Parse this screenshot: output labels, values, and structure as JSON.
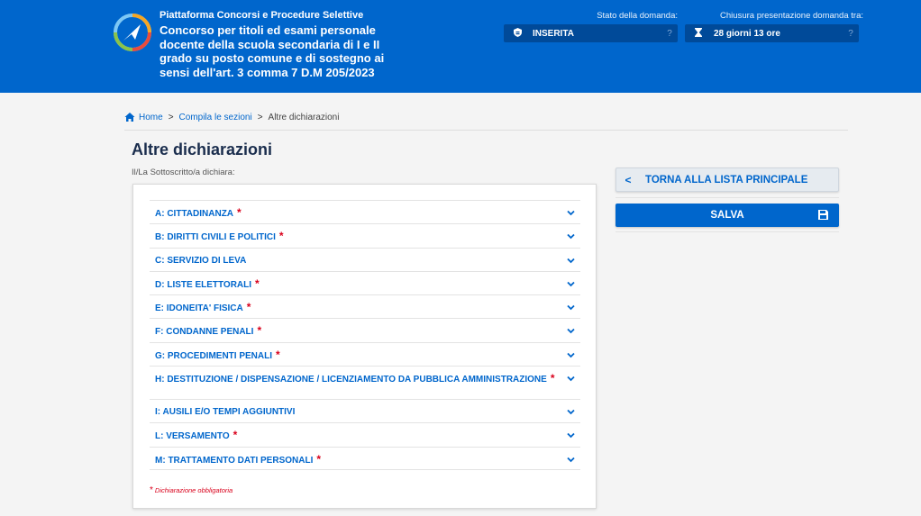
{
  "header": {
    "platform": "Piattaforma Concorsi e Procedure Selettive",
    "title": "Concorso per titoli ed esami personale docente della scuola secondaria di I e II grado su posto comune e di sostegno ai sensi dell'art. 3 comma 7 D.M 205/2023",
    "status_label": "Stato della domanda:",
    "status_value": "INSERITA",
    "deadline_label": "Chiusura presentazione domanda tra:",
    "deadline_value": "28 giorni 13 ore",
    "help_glyph": "?"
  },
  "breadcrumb": {
    "home": "Home",
    "sezioni": "Compila le sezioni",
    "current": "Altre dichiarazioni",
    "sep": ">"
  },
  "page": {
    "title": "Altre dichiarazioni",
    "subtitle": "Il/La Sottoscritto/a dichiara:"
  },
  "sections": [
    {
      "label": "A: CITTADINANZA",
      "required": true
    },
    {
      "label": "B: DIRITTI CIVILI E POLITICI",
      "required": true
    },
    {
      "label": "C: SERVIZIO DI LEVA",
      "required": false
    },
    {
      "label": "D: LISTE ELETTORALI",
      "required": true
    },
    {
      "label": "E: IDONEITA' FISICA",
      "required": true
    },
    {
      "label": "F: CONDANNE PENALI",
      "required": true
    },
    {
      "label": "G: PROCEDIMENTI PENALI",
      "required": true
    },
    {
      "label": "H: DESTITUZIONE / DISPENSAZIONE / LICENZIAMENTO DA PUBBLICA AMMINISTRAZIONE",
      "required": true
    },
    {
      "label": "I: AUSILI E/O TEMPI AGGIUNTIVI",
      "required": false
    },
    {
      "label": "L: VERSAMENTO",
      "required": true
    },
    {
      "label": "M: TRATTAMENTO DATI PERSONALI",
      "required": true
    }
  ],
  "legend": {
    "star": "*",
    "text": "Dichiarazione obbligatoria"
  },
  "actions": {
    "back_arrow": "<",
    "back_label": "TORNA ALLA LISTA PRINCIPALE",
    "save_label": "SALVA"
  },
  "icons": {
    "status": "shield-icon",
    "deadline": "hourglass-icon",
    "home": "home-icon",
    "chevron": "chevron-down-icon",
    "save": "floppy-disk-icon"
  },
  "colors": {
    "primary": "#0066cc",
    "header_box": "#004a99",
    "required": "#d9001b",
    "title": "#1a2d4d"
  }
}
